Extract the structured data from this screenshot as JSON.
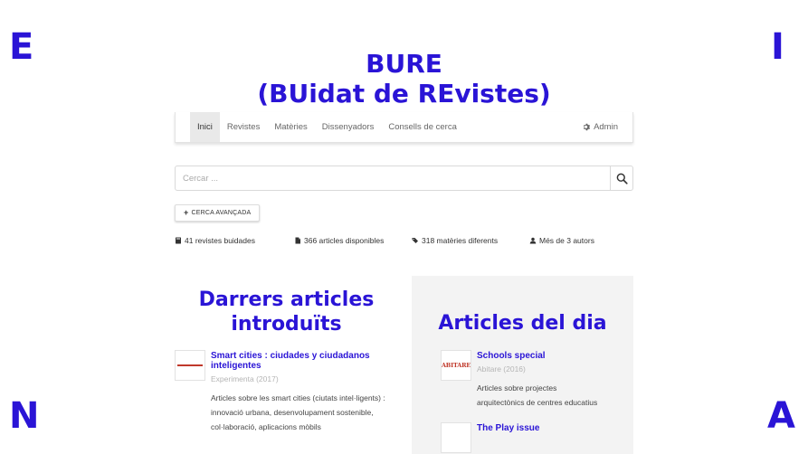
{
  "corners": {
    "tl": "E",
    "tr": "I",
    "bl": "N",
    "br": "A"
  },
  "site": {
    "title_line1": "BURE",
    "title_line2": "(BUidat de REvistes)"
  },
  "nav": {
    "items": [
      {
        "label": "Inici",
        "active": true
      },
      {
        "label": "Revistes"
      },
      {
        "label": "Matèries"
      },
      {
        "label": "Dissenyadors"
      },
      {
        "label": "Consells de cerca"
      }
    ],
    "admin_label": "Admin"
  },
  "search": {
    "placeholder": "Cercar ..."
  },
  "advanced_search": {
    "label": "CERCA AVANÇADA"
  },
  "stats": [
    {
      "icon": "book-icon",
      "text": "41 revistes buidades"
    },
    {
      "icon": "file-icon",
      "text": "366 articles disponibles"
    },
    {
      "icon": "tags-icon",
      "text": "318 matèries diferents"
    },
    {
      "icon": "user-icon",
      "text": "Més de 3 autors"
    }
  ],
  "latest": {
    "heading_line1": "Darrers articles",
    "heading_line2": "introduïts",
    "articles": [
      {
        "title_line1": "Smart cities : ciudades y ciudadanos",
        "title_line2": "inteligentes",
        "meta": "Experimenta (2017)",
        "desc_lines": [
          "Articles sobre les smart cities (ciutats intel·ligents) :",
          "innovació urbana, desenvolupament sostenible,",
          "col·laboració, aplicacions mòbils"
        ]
      }
    ]
  },
  "daily": {
    "heading": "Articles del dia",
    "articles": [
      {
        "thumb_logo": "ABITARE",
        "title": "Schools special",
        "meta": "Abitare (2016)",
        "desc_lines": [
          "Articles sobre projectes",
          "arquitectònics de centres educatius"
        ]
      },
      {
        "title": "The Play issue"
      }
    ]
  }
}
